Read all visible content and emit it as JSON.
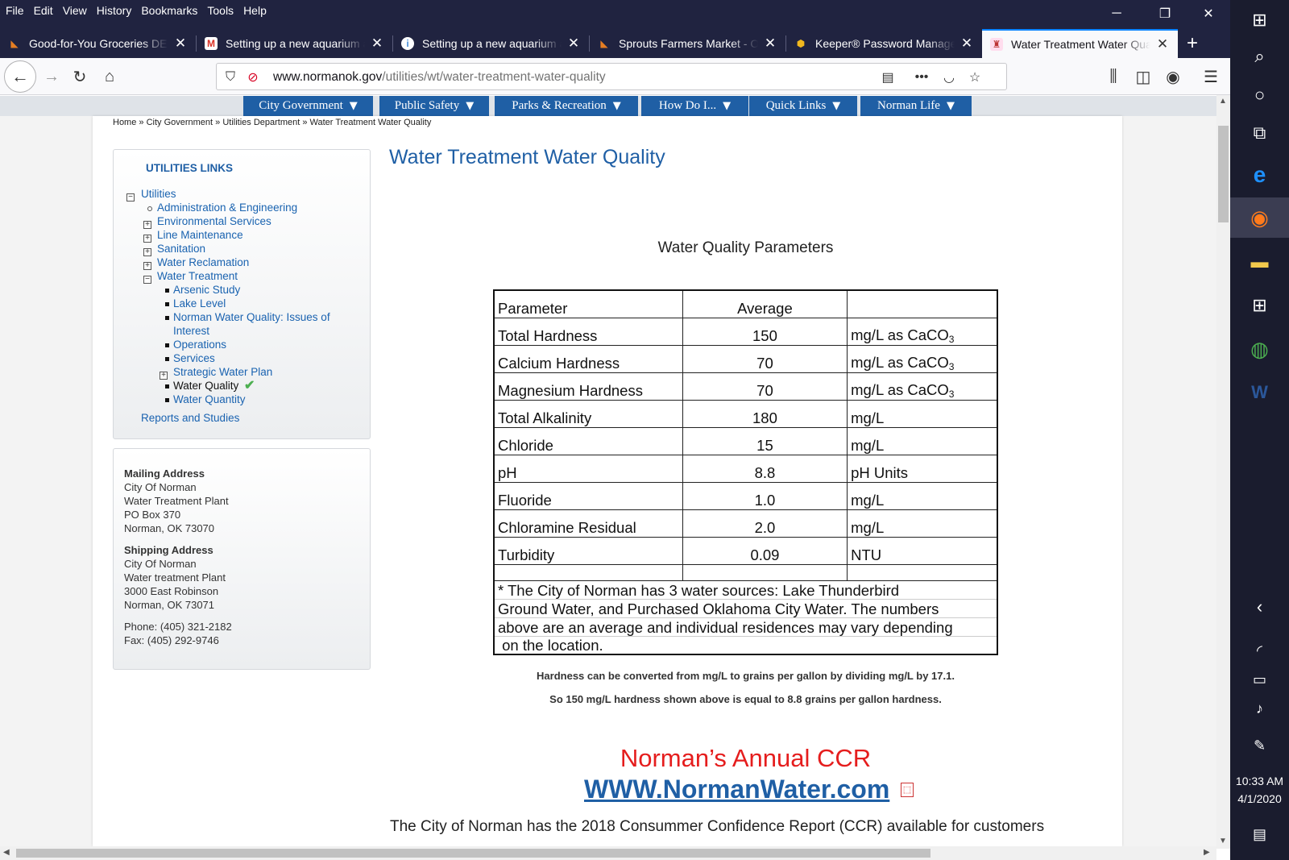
{
  "menu": [
    "File",
    "Edit",
    "View",
    "History",
    "Bookmarks",
    "Tools",
    "Help"
  ],
  "window_controls": {
    "minimize": "─",
    "restore": "❐",
    "close": "✕"
  },
  "tabs": [
    {
      "title": "Good-for-You Groceries DEL",
      "icon": "carrot-icon",
      "color": "#e67e22"
    },
    {
      "title": "Setting up a new aquarium a",
      "icon": "gmail-icon",
      "color": "#d93025"
    },
    {
      "title": "Setting up a new aquarium a",
      "icon": "pdf-icon",
      "color": "#4a90d9"
    },
    {
      "title": "Sprouts Farmers Market - Or",
      "icon": "carrot-icon",
      "color": "#e67e22"
    },
    {
      "title": "Keeper® Password Manager",
      "icon": "keeper-icon",
      "color": "#f1b81e"
    },
    {
      "title": "Water Treatment Water Qual",
      "icon": "norman-icon",
      "color": "#b33"
    }
  ],
  "url": {
    "domain": "www.normanok.gov",
    "path": "/utilities/wt/water-treatment-water-quality"
  },
  "site_nav": [
    "City Government",
    "Public Safety",
    "Parks & Recreation",
    "How Do I...",
    "Quick Links",
    "Norman Life"
  ],
  "breadcrumb": "Home » City Government » Utilities Department » Water Treatment Water Quality",
  "sidebar": {
    "title": "UTILITIES LINKS",
    "root": "Utilities",
    "items": [
      "Administration & Engineering",
      "Environmental Services",
      "Line Maintenance",
      "Sanitation",
      "Water Reclamation",
      "Water Treatment"
    ],
    "sub_items": [
      "Arsenic Study",
      "Lake Level",
      "Norman Water Quality: Issues of",
      "Interest",
      "Operations",
      "Services",
      "Strategic Water Plan",
      "Water Quality",
      "Water Quantity"
    ],
    "reports": "Reports and Studies"
  },
  "address": {
    "mailing_label": "Mailing Address",
    "mailing": [
      "City Of Norman",
      "Water Treatment Plant",
      "PO Box 370",
      "Norman, OK 73070"
    ],
    "shipping_label": "Shipping Address",
    "shipping": [
      "City Of Norman",
      "Water treatment Plant",
      "3000 East Robinson",
      "Norman, OK 73071"
    ],
    "phone": "Phone: (405) 321-2182",
    "fax": "Fax: (405) 292-9746"
  },
  "main": {
    "title": "Water Treatment Water Quality",
    "table_caption": "Water Quality Parameters",
    "header": {
      "parameter": "Parameter",
      "average": "Average"
    },
    "rows": [
      {
        "param": "Total Hardness",
        "avg": "150",
        "unit": "mg/L as CaCO",
        "sub": "3"
      },
      {
        "param": "Calcium Hardness",
        "avg": "70",
        "unit": "mg/L as CaCO",
        "sub": "3"
      },
      {
        "param": "Magnesium Hardness",
        "avg": "70",
        "unit": "mg/L as CaCO",
        "sub": "3"
      },
      {
        "param": "Total Alkalinity",
        "avg": "180",
        "unit": "mg/L",
        "sub": ""
      },
      {
        "param": "Chloride",
        "avg": "15",
        "unit": "mg/L",
        "sub": ""
      },
      {
        "param": "pH",
        "avg": "8.8",
        "unit": "pH Units",
        "sub": ""
      },
      {
        "param": "Fluoride",
        "avg": "1.0",
        "unit": "mg/L",
        "sub": ""
      },
      {
        "param": "Chloramine Residual",
        "avg": "2.0",
        "unit": "mg/L",
        "sub": ""
      },
      {
        "param": "Turbidity",
        "avg": "0.09",
        "unit": "NTU",
        "sub": ""
      }
    ],
    "note_lines": [
      "* The City of Norman has 3 water sources: Lake Thunderbird",
      "Ground Water, and Purchased Oklahoma City Water.  The numbers",
      "above are an average and individual residences may vary depending",
      " on the location."
    ],
    "conversion_1": "Hardness can be converted from mg/L to grains per gallon by dividing mg/L by 17.1.",
    "conversion_2": "So 150 mg/L hardness shown above is equal to 8.8 grains per gallon hardness.",
    "ccr_title": "Norman’s Annual CCR",
    "ccr_link": "WWW.NormanWater.com",
    "cutoff_text": "The City of Norman has the 2018 Consummer Confidence Report (CCR) available for customers"
  },
  "clock": {
    "time": "10:33 AM",
    "date": "4/1/2020"
  }
}
